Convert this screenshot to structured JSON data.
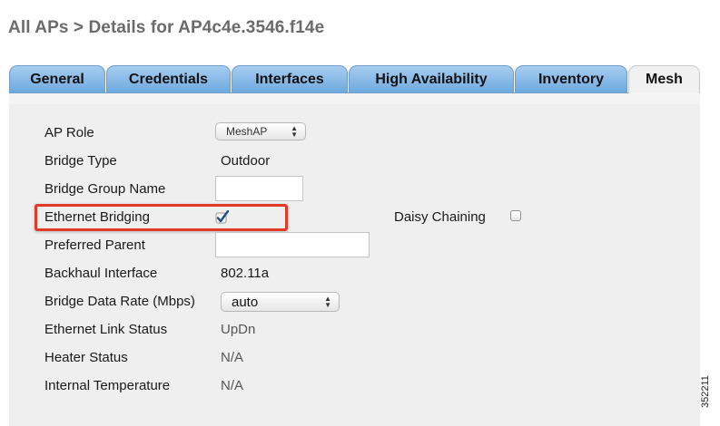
{
  "breadcrumb": "All APs > Details for AP4c4e.3546.f14e",
  "tabs": [
    "General",
    "Credentials",
    "Interfaces",
    "High Availability",
    "Inventory",
    "Mesh"
  ],
  "active_tab": "Mesh",
  "fields": {
    "ap_role": {
      "label": "AP Role",
      "value": "MeshAP"
    },
    "bridge_type": {
      "label": "Bridge Type",
      "value": "Outdoor"
    },
    "bridge_group_name": {
      "label": "Bridge Group Name",
      "value": ""
    },
    "ethernet_bridging": {
      "label": "Ethernet Bridging",
      "checked": true
    },
    "daisy_chaining": {
      "label": "Daisy Chaining",
      "checked": false
    },
    "preferred_parent": {
      "label": "Preferred Parent",
      "value": ""
    },
    "backhaul_interface": {
      "label": "Backhaul Interface",
      "value": "802.11a"
    },
    "bridge_data_rate": {
      "label": "Bridge Data Rate (Mbps)",
      "value": "auto"
    },
    "ethernet_link_status": {
      "label": "Ethernet Link Status",
      "value": "UpDn"
    },
    "heater_status": {
      "label": "Heater Status",
      "value": "N/A"
    },
    "internal_temperature": {
      "label": "Internal Temperature",
      "value": "N/A"
    }
  },
  "figure_id": "352211",
  "colors": {
    "highlight": "#e23a2a",
    "tab_blue": "#8bbde9",
    "title_gray": "#6b6b6b",
    "check_blue": "#1f4f8f"
  },
  "icons": {
    "select_arrows": "up-down-chevron-icon",
    "checkmark": "checkmark-icon"
  }
}
